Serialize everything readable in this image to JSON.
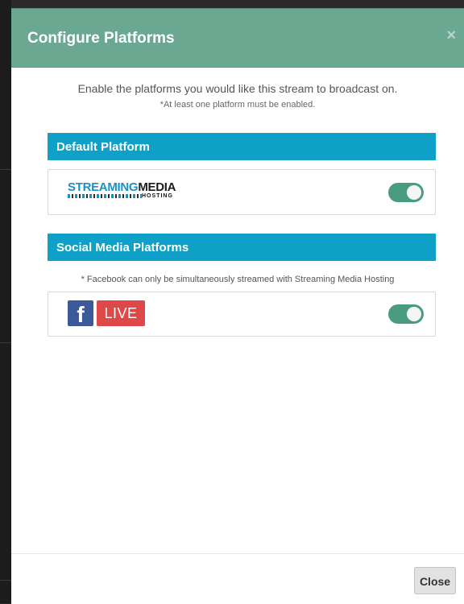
{
  "dialog": {
    "title": "Configure Platforms",
    "close_glyph": "×",
    "intro": "Enable the platforms you would like this stream to broadcast on.",
    "intro_note": "*At least one platform must be enabled."
  },
  "default_section": {
    "heading": "Default Platform",
    "platform": {
      "logo_text_part1": "STREAMING",
      "logo_text_part2": "MEDIA",
      "logo_subtext": "HOSTING",
      "enabled": true
    }
  },
  "social_section": {
    "heading": "Social Media Platforms",
    "note": "* Facebook can only be simultaneously streamed with Streaming Media Hosting",
    "platform": {
      "logo_icon": "facebook-f-icon",
      "logo_glyph": "f",
      "logo_badge": "LIVE",
      "enabled": true
    }
  },
  "footer": {
    "close_label": "Close"
  },
  "colors": {
    "header": "#6aa892",
    "section_header": "#0fa0c8",
    "toggle_on": "#4a9c81",
    "facebook_blue": "#3b5998",
    "live_red": "#de4848"
  }
}
